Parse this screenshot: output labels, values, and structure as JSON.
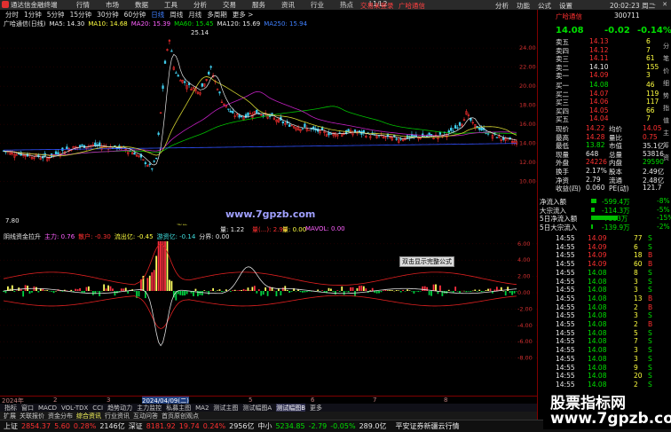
{
  "titlebar": {
    "app": "通达信金融终端",
    "menu": [
      "行情",
      "市场",
      "数据",
      "工具",
      "分析",
      "交易",
      "服务",
      "资讯",
      "行业",
      "热点",
      "L1/L2"
    ],
    "promo": "交易未登录",
    "promo2": "广哈通信",
    "right": [
      "分析",
      "功能",
      "公式",
      "设置"
    ],
    "clock": "20:02:23 周二"
  },
  "period": {
    "items": [
      "分时",
      "1分钟",
      "5分钟",
      "15分钟",
      "30分钟",
      "60分钟",
      "日线",
      "周线",
      "月线",
      "多周期",
      "更多 >"
    ],
    "active": "日线"
  },
  "info": {
    "name": "广哈通信(日线)",
    "ma5": "MA5: 14.30",
    "ma10": "MA10: 14.68",
    "ma20": "MA20: 15.39",
    "ma60": "MA60: 15.45",
    "ma120": "MA120: 15.69",
    "ma250": "MA250: 15.94"
  },
  "chart": {
    "high_label": "25.14",
    "low_label": "7.80",
    "y_ticks": [
      "24.00",
      "22.00",
      "20.00",
      "18.00",
      "16.00",
      "14.00",
      "12.00",
      "10.00"
    ],
    "site": "www.7gpzb.com",
    "mark": "涨停"
  },
  "volinfo": {
    "v1": "量: 1.22",
    "v2": "量(...): 2.98",
    "v3": "量: 0.00",
    "v4": "MAVOL: 0.00"
  },
  "indinfo": {
    "name": "阴线资金拉升",
    "i1": "主力: 0.76",
    "i2": "散户: -0.30",
    "i3": "流出亿: -0.45",
    "i4": "游资亿: -0.14",
    "i5": "分界: 0.00"
  },
  "ind_ticks": [
    "8.00",
    "6.00",
    "4.00",
    "2.00",
    "0.00",
    "-2.00",
    "-4.00",
    "-6.00",
    "-8.00"
  ],
  "datebar": {
    "d1": "2024年",
    "d2": "2",
    "d3": "3",
    "d4": "2024/04/09(二)",
    "d5": "5",
    "d6": "6",
    "d7": "7",
    "d8": "8"
  },
  "indtabs": {
    "items": [
      "指标",
      "窗口",
      "MACD",
      "VOL-TDX",
      "CCI",
      "趋势动力",
      "主力监控",
      "私募主图",
      "MA2",
      "测试主图",
      "测试幅图A",
      "测试幅图B",
      "更多"
    ],
    "active": "测试幅图B"
  },
  "bottabs": {
    "items": [
      "扩展",
      "关联报价",
      "资金分布",
      "综合资讯",
      "行业资讯",
      "互动问答",
      "首页原创观点"
    ],
    "active": "综合资讯"
  },
  "status": {
    "sh_label": "上证",
    "sh_val": "2854.37",
    "sh_chg": "5.60",
    "sh_pct": "0.28%",
    "sh_amt": "2146亿",
    "sz_label": "深证",
    "sz_val": "8181.92",
    "sz_chg": "19.74",
    "sz_pct": "0.24%",
    "sz_amt": "2956亿",
    "zx_label": "中小",
    "zx_val": "5234.85",
    "zx_chg": "-2.79",
    "zx_pct": "-0.05%",
    "zx_amt": "289.0亿",
    "broker": "平安证券新疆云行情"
  },
  "rp": {
    "name": "广哈通信",
    "code": "300711",
    "price": "14.08",
    "chg": "-0.02",
    "pct": "-0.14%",
    "sells": [
      {
        "l": "卖五",
        "p": "14.13",
        "v": "6"
      },
      {
        "l": "卖四",
        "p": "14.12",
        "v": "7"
      },
      {
        "l": "卖三",
        "p": "14.11",
        "v": "61"
      },
      {
        "l": "卖二",
        "p": "14.10",
        "v": "155"
      },
      {
        "l": "卖一",
        "p": "14.09",
        "v": "3"
      }
    ],
    "buys": [
      {
        "l": "买一",
        "p": "14.08",
        "v": "46"
      },
      {
        "l": "买二",
        "p": "14.07",
        "v": "119"
      },
      {
        "l": "买三",
        "p": "14.06",
        "v": "117"
      },
      {
        "l": "买四",
        "p": "14.05",
        "v": "66"
      },
      {
        "l": "买五",
        "p": "14.04",
        "v": "7"
      }
    ],
    "stats": [
      {
        "a": "现价",
        "av": "14.22",
        "b": "均价",
        "bv": "14.05"
      },
      {
        "a": "最高",
        "av": "14.28",
        "b": "量比",
        "bv": "0.75"
      },
      {
        "a": "最低",
        "av": "13.82",
        "b": "市值",
        "bv": "35.1亿"
      },
      {
        "a": "现量",
        "av": "648",
        "b": "总量",
        "bv": "53816"
      },
      {
        "a": "外盘",
        "av": "24226",
        "b": "内盘",
        "bv": "29590"
      },
      {
        "a": "换手",
        "av": "2.17%",
        "b": "股本",
        "bv": "2.49亿"
      },
      {
        "a": "净资",
        "av": "2.79",
        "b": "流通",
        "bv": "2.48亿"
      },
      {
        "a": "收益(四)",
        "av": "0.060",
        "b": "PE(动)",
        "bv": "121.7"
      }
    ],
    "flows": [
      {
        "l": "净流入额",
        "v": "-599.4万",
        "p": "-8%"
      },
      {
        "l": "大宗流入",
        "v": "-114.3万",
        "p": "-5%"
      },
      {
        "l": "5日净流入额",
        "v": "-7803万",
        "p": "-15%"
      },
      {
        "l": "5日大宗流入",
        "v": "-139.9万",
        "p": "-2%"
      }
    ],
    "ticks": [
      {
        "t": "14:55",
        "p": "14.09",
        "v": "77",
        "d": "S"
      },
      {
        "t": "14:55",
        "p": "14.09",
        "v": "6",
        "d": "S"
      },
      {
        "t": "14:55",
        "p": "14.09",
        "v": "18",
        "d": "B"
      },
      {
        "t": "14:55",
        "p": "14.09",
        "v": "60",
        "d": "B"
      },
      {
        "t": "14:55",
        "p": "14.08",
        "v": "8",
        "d": "S"
      },
      {
        "t": "14:55",
        "p": "14.08",
        "v": "3",
        "d": "S"
      },
      {
        "t": "14:55",
        "p": "14.08",
        "v": "3",
        "d": "S"
      },
      {
        "t": "14:55",
        "p": "14.08",
        "v": "13",
        "d": "B"
      },
      {
        "t": "14:55",
        "p": "14.08",
        "v": "2",
        "d": "B"
      },
      {
        "t": "14:55",
        "p": "14.08",
        "v": "3",
        "d": "S"
      },
      {
        "t": "14:55",
        "p": "14.08",
        "v": "2",
        "d": "B"
      },
      {
        "t": "14:55",
        "p": "14.08",
        "v": "5",
        "d": "S"
      },
      {
        "t": "14:55",
        "p": "14.08",
        "v": "7",
        "d": "S"
      },
      {
        "t": "14:55",
        "p": "14.08",
        "v": "3",
        "d": "S"
      },
      {
        "t": "14:55",
        "p": "14.08",
        "v": "3",
        "d": "S"
      },
      {
        "t": "14:55",
        "p": "14.08",
        "v": "9",
        "d": "S"
      },
      {
        "t": "14:55",
        "p": "14.08",
        "v": "20",
        "d": "S"
      },
      {
        "t": "14:55",
        "p": "14.08",
        "v": "2",
        "d": "S"
      },
      {
        "t": "14:55",
        "p": "14.08",
        "v": "22",
        "d": "S"
      }
    ]
  },
  "watermark": {
    "a": "股票指标网",
    "b": "www.7gpzb.com"
  },
  "tooltip": "双击显示完整公式"
}
